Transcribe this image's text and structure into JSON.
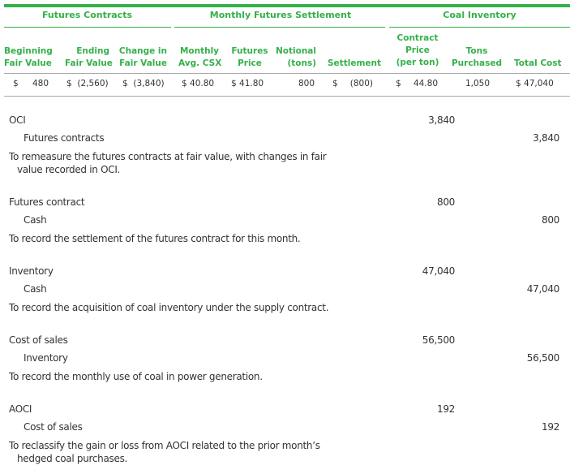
{
  "table": {
    "groups": [
      "Futures Contracts",
      "Monthly Futures Settlement",
      "Coal Inventory"
    ],
    "columns": [
      [
        "Beginning",
        "Fair Value"
      ],
      [
        "Ending",
        "Fair Value"
      ],
      [
        "Change in",
        "Fair Value"
      ],
      [
        "Monthly",
        "Avg. CSX"
      ],
      [
        "Futures",
        "Price"
      ],
      [
        "Notional",
        "(tons)"
      ],
      [
        "Settlement"
      ],
      [
        "Contract",
        "Price",
        "(per ton)"
      ],
      [
        "Tons",
        "Purchased"
      ],
      [
        "Total Cost"
      ]
    ],
    "row": {
      "beginning_fv_cur": "$",
      "beginning_fv": "480",
      "ending_fv": "$  (2,560)",
      "change_fv": "$  (3,840)",
      "monthly_avg_csx": "$ 40.80",
      "futures_price": "$ 41.80",
      "notional": "800",
      "settlement_cur": "$",
      "settlement": "(800)",
      "contract_price_cur": "$",
      "contract_price": "44.80",
      "tons_purchased": "1,050",
      "total_cost": "$ 47,040"
    }
  },
  "journal_entries": [
    {
      "debit_account": "OCI",
      "debit_amount": "3,840",
      "credit_account": "Futures contracts",
      "credit_amount": "3,840",
      "memo_line1": "To remeasure the futures contracts at fair value, with changes in fair",
      "memo_line2": "value recorded in OCI."
    },
    {
      "debit_account": "Futures contract",
      "debit_amount": "800",
      "credit_account": "Cash",
      "credit_amount": "800",
      "memo_line1": "To record the settlement of the futures contract for this month.",
      "memo_line2": ""
    },
    {
      "debit_account": "Inventory",
      "debit_amount": "47,040",
      "credit_account": "Cash",
      "credit_amount": "47,040",
      "memo_line1": "To record the acquisition of coal inventory under the supply contract.",
      "memo_line2": ""
    },
    {
      "debit_account": "Cost of sales",
      "debit_amount": "56,500",
      "credit_account": "Inventory",
      "credit_amount": "56,500",
      "memo_line1": "To record the monthly use of coal in power generation.",
      "memo_line2": ""
    },
    {
      "debit_account": "AOCI",
      "debit_amount": "192",
      "credit_account": "Cost of sales",
      "credit_amount": "192",
      "memo_line1": "To reclassify the gain or loss from AOCI related to the prior month’s",
      "memo_line2": "hedged coal purchases."
    }
  ],
  "colors": {
    "accent": "#35b04a",
    "rule": "#aaaaaa",
    "text": "#333333"
  }
}
